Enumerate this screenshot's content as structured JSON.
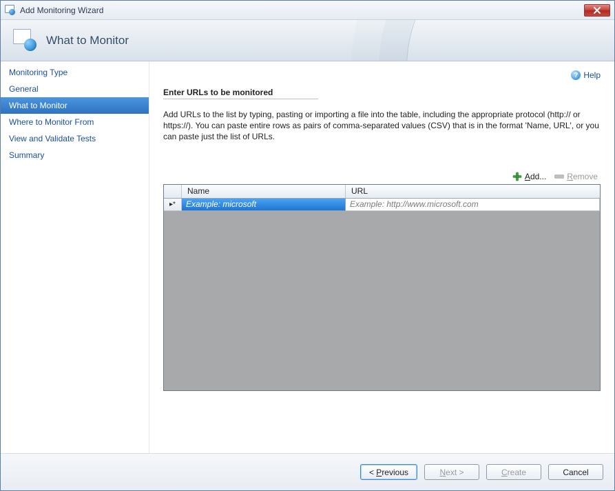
{
  "window": {
    "title": "Add Monitoring Wizard"
  },
  "header": {
    "title": "What to Monitor"
  },
  "help": {
    "label": "Help"
  },
  "sidebar": {
    "items": [
      {
        "label": "Monitoring Type",
        "active": false
      },
      {
        "label": "General",
        "active": false
      },
      {
        "label": "What to Monitor",
        "active": true
      },
      {
        "label": "Where to Monitor From",
        "active": false
      },
      {
        "label": "View and Validate Tests",
        "active": false
      },
      {
        "label": "Summary",
        "active": false
      }
    ]
  },
  "section": {
    "title": "Enter URLs to be monitored",
    "instructions": "Add URLs to the list by typing, pasting or importing a file into the table, including the appropriate protocol (http:// or https://). You can paste entire rows as pairs of comma-separated values (CSV) that is in the format 'Name, URL', or you can paste just the list of URLs."
  },
  "toolbar": {
    "add_prefix": "A",
    "add_rest": "dd...",
    "remove_prefix": "R",
    "remove_rest": "emove",
    "remove_enabled": false
  },
  "grid": {
    "columns": {
      "name": "Name",
      "url": "URL"
    },
    "new_row_indicator": "▸*",
    "placeholders": {
      "name": "Example: microsoft",
      "url": "Example: http://www.microsoft.com"
    }
  },
  "footer": {
    "previous_prefix": "< ",
    "previous_u": "P",
    "previous_rest": "revious",
    "next_u": "N",
    "next_rest": "ext >",
    "create_u": "C",
    "create_rest": "reate",
    "cancel": "Cancel",
    "next_enabled": false,
    "create_enabled": false
  }
}
